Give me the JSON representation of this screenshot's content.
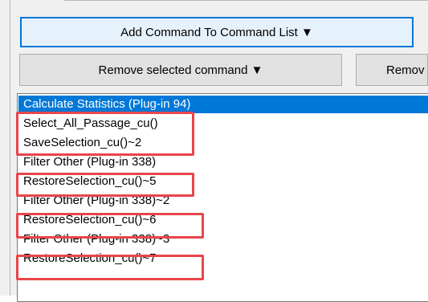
{
  "buttons": {
    "add_command": "Add Command To Command List ▼",
    "remove_selected": "Remove selected command ▼",
    "remove_other_partial": "Remov"
  },
  "command_list": {
    "items": [
      "Calculate Statistics (Plug-in 94)",
      "Select_All_Passage_cu()",
      "SaveSelection_cu()~2",
      "Filter Other (Plug-in 338)",
      "RestoreSelection_cu()~5",
      "Filter Other (Plug-in 338)~2",
      "RestoreSelection_cu()~6",
      "Filter Other (Plug-in 338)~3",
      "RestoreSelection_cu()~7"
    ],
    "selected_index": 0
  },
  "highlight_color": "#e8454a",
  "selection_color": "#0078d7"
}
